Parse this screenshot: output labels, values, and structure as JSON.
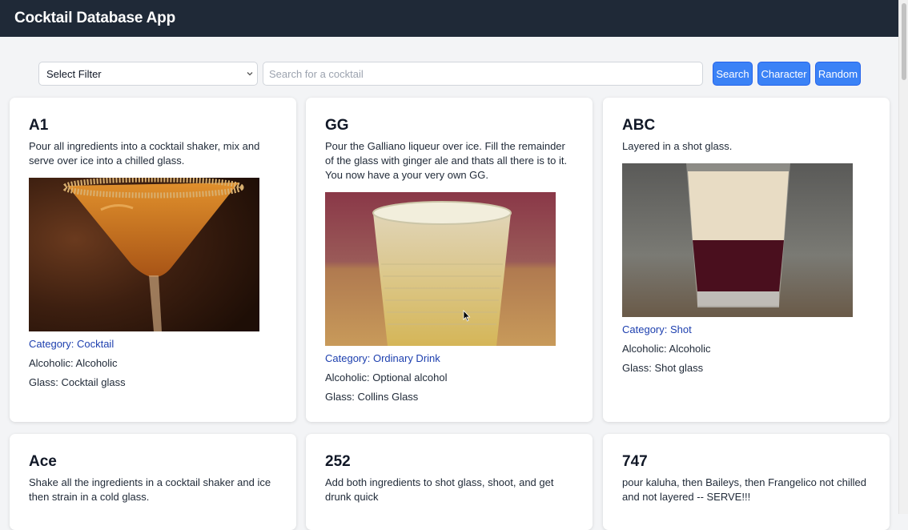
{
  "app": {
    "title": "Cocktail Database App"
  },
  "controls": {
    "filter_value": "Select Filter",
    "search_placeholder": "Search for a cocktail",
    "search_label": "Search",
    "character_label": "Character",
    "random_label": "Random"
  },
  "cards": [
    {
      "name": "A1",
      "instructions": "Pour all ingredients into a cocktail shaker, mix and serve over ice into a chilled glass.",
      "category": "Category: Cocktail",
      "alcoholic": "Alcoholic: Alcoholic",
      "glass": "Glass: Cocktail glass"
    },
    {
      "name": "GG",
      "instructions": "Pour the Galliano liqueur over ice. Fill the remainder of the glass with ginger ale and thats all there is to it. You now have a your very own GG.",
      "category": "Category: Ordinary Drink",
      "alcoholic": "Alcoholic: Optional alcohol",
      "glass": "Glass: Collins Glass"
    },
    {
      "name": "ABC",
      "instructions": "Layered in a shot glass.",
      "category": "Category: Shot",
      "alcoholic": "Alcoholic: Alcoholic",
      "glass": "Glass: Shot glass"
    },
    {
      "name": "Ace",
      "instructions": "Shake all the ingredients in a cocktail shaker and ice then strain in a cold glass."
    },
    {
      "name": "252",
      "instructions": "Add both ingredients to shot glass, shoot, and get drunk quick"
    },
    {
      "name": "747",
      "instructions": "pour kaluha, then Baileys, then Frangelico not chilled and not layered -- SERVE!!!"
    }
  ],
  "colors": {
    "header_bg": "#1f2937",
    "accent": "#3b82f6",
    "category_text": "#1e40af",
    "page_bg": "#f3f4f6"
  }
}
